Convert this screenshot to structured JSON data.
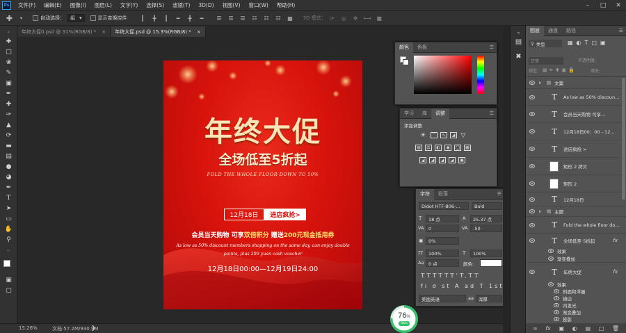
{
  "menu": [
    "文件(F)",
    "编辑(E)",
    "图像(I)",
    "图层(L)",
    "文字(Y)",
    "选择(S)",
    "滤镜(T)",
    "3D(D)",
    "视图(V)",
    "窗口(W)",
    "帮助(H)"
  ],
  "options": {
    "auto_select": "自动选择：",
    "group_select": "组",
    "show_transform": "显示变换控件",
    "mode_3d": "3D 模式："
  },
  "tabs": [
    {
      "label": "年终大促0.psd @ 31%(RGB/8) *"
    },
    {
      "label": "年终大促.psd @ 15.3%(RGB/8) *"
    }
  ],
  "poster": {
    "title": "年终大促",
    "subtitle": "全场低至5折起",
    "english_line": "FOLD THE WHOLE FLOOR DOWN TO 50%",
    "date_box": "12月18日",
    "cta": "进店疯抢>",
    "benefit_prefix": "会员当天购物 可享",
    "benefit_highlight1": "双倍积分",
    "benefit_mid": " 赠送",
    "benefit_highlight2": "200元现金抵用券",
    "desc_line1": "As low as 50% discount members shopping on the same day, can enjoy double",
    "desc_line2": "points, plus 200 yuan cash voucher",
    "period": "12月18日00:00—12月19日24:00"
  },
  "status": {
    "zoom": "15.26%",
    "doc": "文档:57.2M/930.9M"
  },
  "badge": {
    "percent": "76",
    "percent_unit": "%",
    "speed": "0K/s",
    "progress": 0.76
  },
  "color_panel": {
    "tabs": [
      "颜色",
      "色板"
    ]
  },
  "adjust_panel": {
    "tabs": [
      "学习",
      "库",
      "调整"
    ],
    "add_label": "添加调整"
  },
  "char_panel": {
    "tabs": [
      "字符",
      "段落"
    ],
    "font": "Didot HTF-B06-...",
    "style": "Bold",
    "size": "18 点",
    "leading": "25.37 点",
    "kerning": "0",
    "tracking": "-50",
    "scale_pct": "0%",
    "vscale": "100%",
    "hscale": "100%",
    "baseline": "0 点",
    "color_label": "颜色:",
    "language": "美国英语",
    "aa_label": "aa",
    "aa_mode": "浑厚"
  },
  "layers_panel": {
    "tabs": [
      "图层",
      "通道",
      "路径"
    ],
    "kind": "类型",
    "blend": "正常",
    "opacity_label": "不透明度:",
    "lock_label": "锁定:",
    "fill_label": "填充:"
  },
  "layers": [
    {
      "name": "文案",
      "type": "group"
    },
    {
      "name": "As low as 50% discoun...",
      "type": "text"
    },
    {
      "name": "会员当天购物 可享...",
      "type": "text"
    },
    {
      "name": "12月18日00：00 - 12...",
      "type": "text"
    },
    {
      "name": "进店疯抢 >",
      "type": "text"
    },
    {
      "name": "矩形 2 拷贝",
      "type": "shape"
    },
    {
      "name": "矩形 2",
      "type": "shape"
    },
    {
      "name": "12月18日",
      "type": "text"
    },
    {
      "name": "主题",
      "type": "group"
    },
    {
      "name": "Fold the whole floor do...",
      "type": "text"
    },
    {
      "name": "全场低至 5折起",
      "type": "text",
      "fx": "fx"
    },
    {
      "name": "效果",
      "type": "effect"
    },
    {
      "name": "渐变叠加",
      "type": "effect-item"
    },
    {
      "name": "年终大促",
      "type": "text",
      "fx": "fx"
    },
    {
      "name": "效果",
      "type": "effect"
    },
    {
      "name": "斜面和浮雕",
      "type": "effect-item"
    },
    {
      "name": "描边",
      "type": "effect-item"
    },
    {
      "name": "内发光",
      "type": "effect-item"
    },
    {
      "name": "渐变叠加",
      "type": "effect-item"
    },
    {
      "name": "投影",
      "type": "effect-item"
    }
  ],
  "colors": {
    "accent": "#31a8ff",
    "poster_red": "#d7130c",
    "gold": "#f3d8a1",
    "badge_green": "#36c26a"
  }
}
